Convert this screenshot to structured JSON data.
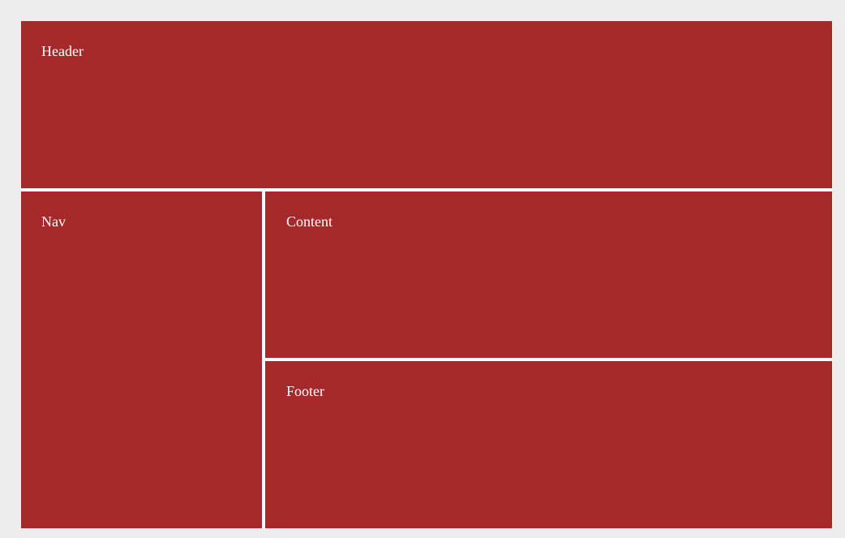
{
  "layout": {
    "header": {
      "label": "Header"
    },
    "nav": {
      "label": "Nav"
    },
    "content": {
      "label": "Content"
    },
    "footer": {
      "label": "Footer"
    }
  },
  "colors": {
    "page_background": "#ededed",
    "cell_background": "#a5292a",
    "cell_text": "#ffffff",
    "gutter": "#ffffff"
  }
}
